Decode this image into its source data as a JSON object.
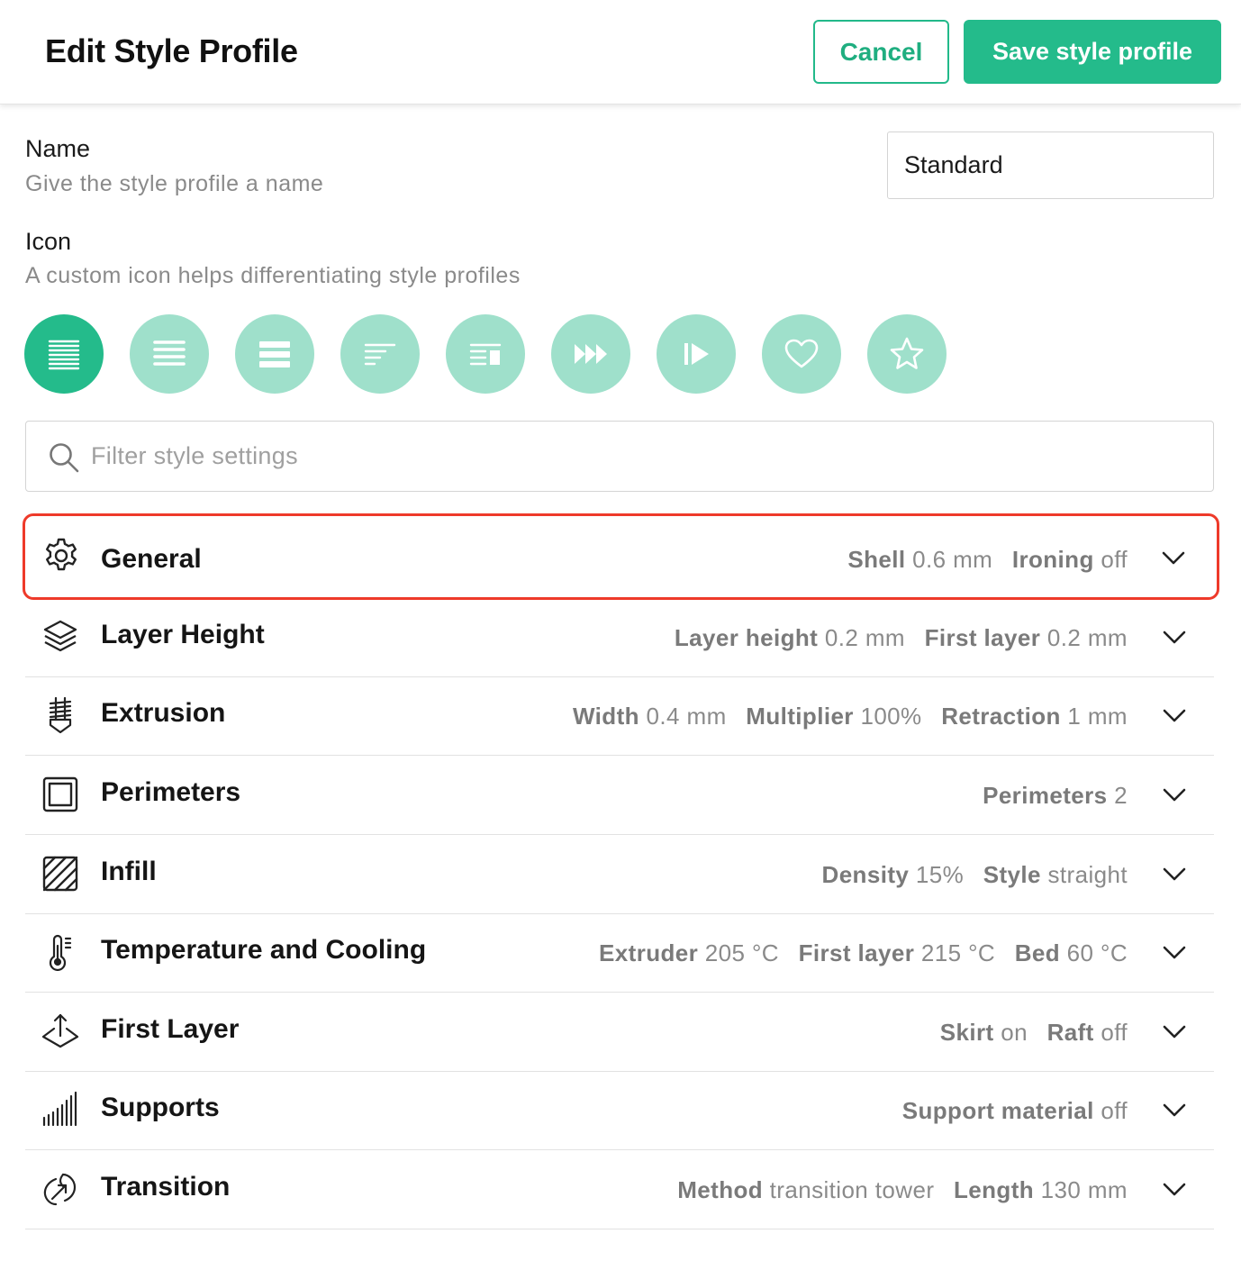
{
  "header": {
    "title": "Edit Style Profile",
    "cancel_label": "Cancel",
    "save_label": "Save style profile"
  },
  "name_field": {
    "label": "Name",
    "help": "Give the style profile a name",
    "value": "Standard"
  },
  "icon_field": {
    "label": "Icon",
    "help": "A custom icon helps differentiating style profiles",
    "options": [
      {
        "icon": "lines-dense-icon",
        "selected": true
      },
      {
        "icon": "lines-medium-icon",
        "selected": false
      },
      {
        "icon": "lines-thick-icon",
        "selected": false
      },
      {
        "icon": "lines-left-align-icon",
        "selected": false
      },
      {
        "icon": "lines-with-box-icon",
        "selected": false
      },
      {
        "icon": "fast-forward-icon",
        "selected": false
      },
      {
        "icon": "skip-play-icon",
        "selected": false
      },
      {
        "icon": "heart-icon",
        "selected": false
      },
      {
        "icon": "star-icon",
        "selected": false
      }
    ]
  },
  "search": {
    "placeholder": "Filter style settings"
  },
  "sections": [
    {
      "id": "general",
      "icon": "gear-icon",
      "title": "General",
      "highlighted": true,
      "summary": [
        {
          "k": "Shell",
          "v": "0.6 mm"
        },
        {
          "k": "Ironing",
          "v": "off"
        }
      ]
    },
    {
      "id": "layer-height",
      "icon": "layers-icon",
      "title": "Layer Height",
      "summary": [
        {
          "k": "Layer height",
          "v": "0.2 mm"
        },
        {
          "k": "First layer",
          "v": "0.2 mm"
        }
      ]
    },
    {
      "id": "extrusion",
      "icon": "extruder-icon",
      "title": "Extrusion",
      "summary": [
        {
          "k": "Width",
          "v": "0.4 mm"
        },
        {
          "k": "Multiplier",
          "v": "100%"
        },
        {
          "k": "Retraction",
          "v": "1 mm"
        }
      ]
    },
    {
      "id": "perimeters",
      "icon": "perimeters-icon",
      "title": "Perimeters",
      "summary": [
        {
          "k": "Perimeters",
          "v": "2"
        }
      ]
    },
    {
      "id": "infill",
      "icon": "infill-icon",
      "title": "Infill",
      "summary": [
        {
          "k": "Density",
          "v": "15%"
        },
        {
          "k": "Style",
          "v": "straight"
        }
      ]
    },
    {
      "id": "temperature",
      "icon": "thermometer-icon",
      "title": "Temperature and Cooling",
      "summary": [
        {
          "k": "Extruder",
          "v": "205 °C"
        },
        {
          "k": "First layer",
          "v": "215 °C"
        },
        {
          "k": "Bed",
          "v": "60 °C"
        }
      ]
    },
    {
      "id": "first-layer",
      "icon": "first-layer-icon",
      "title": "First Layer",
      "summary": [
        {
          "k": "Skirt",
          "v": "on"
        },
        {
          "k": "Raft",
          "v": "off"
        }
      ]
    },
    {
      "id": "supports",
      "icon": "supports-icon",
      "title": "Supports",
      "summary": [
        {
          "k": "Support material",
          "v": "off"
        }
      ]
    },
    {
      "id": "transition",
      "icon": "transition-icon",
      "title": "Transition",
      "summary": [
        {
          "k": "Method",
          "v": "transition tower"
        },
        {
          "k": "Length",
          "v": "130 mm"
        }
      ]
    }
  ],
  "colors": {
    "accent": "#24bb8b",
    "accent_light": "#9fe0cb",
    "highlight": "#ee3a2a"
  }
}
